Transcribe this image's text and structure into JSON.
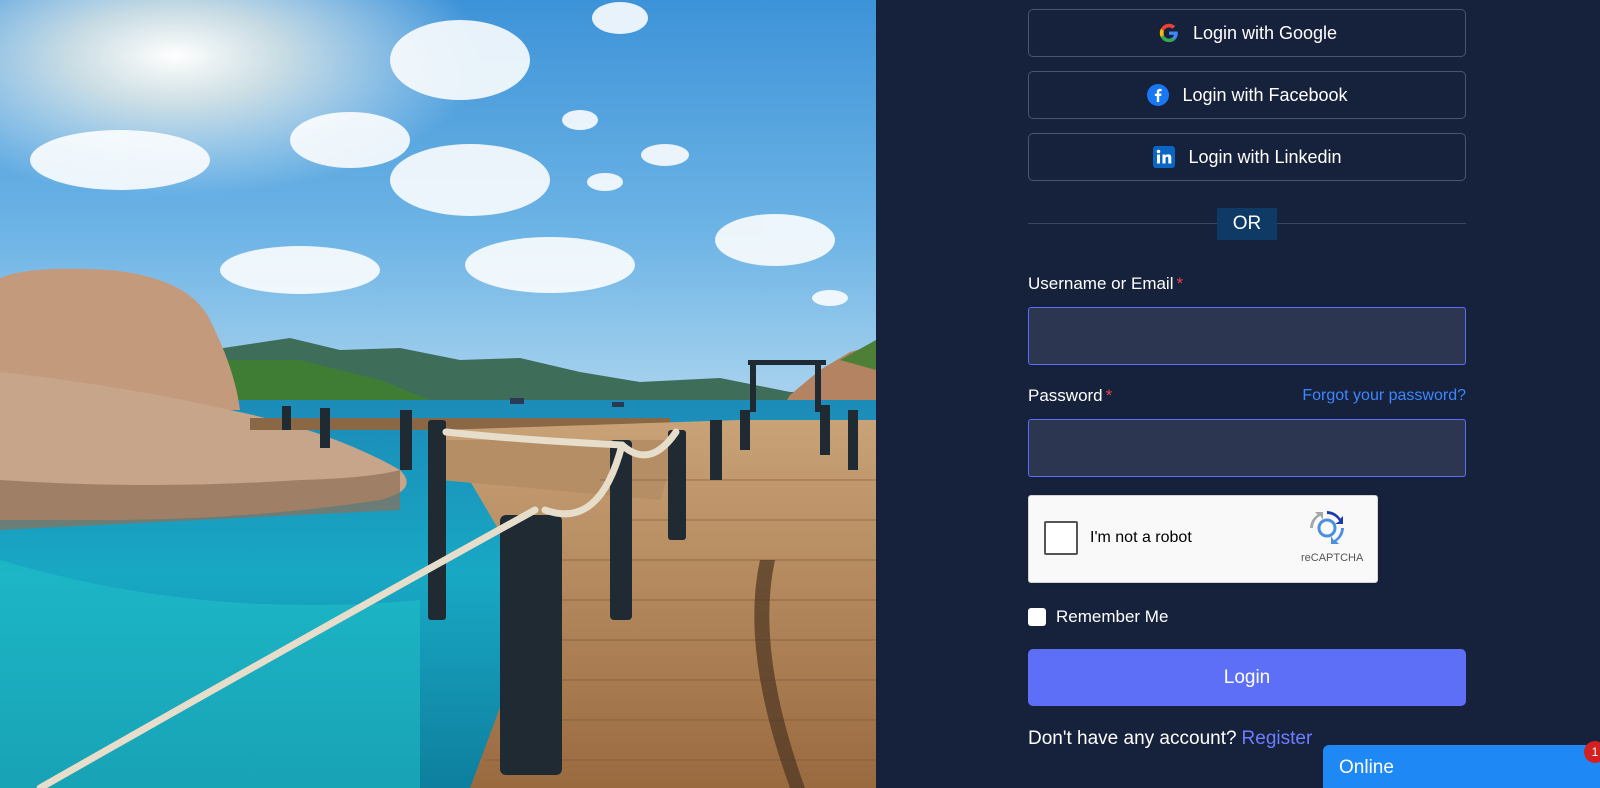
{
  "social": {
    "google_label": "Login with Google",
    "facebook_label": "Login with Facebook",
    "linkedin_label": "Login with Linkedin",
    "google_icon": "google-g-icon",
    "facebook_icon": "facebook-icon",
    "linkedin_icon": "linkedin-icon"
  },
  "divider": {
    "or_text": "OR"
  },
  "form": {
    "username_label": "Username or Email",
    "required_mark": "*",
    "username_value": "",
    "password_label": "Password",
    "password_value": "",
    "forgot_link": "Forgot your password?",
    "remember_label": "Remember Me",
    "remember_checked": false,
    "login_label": "Login",
    "no_account_text": "Don't have any account?",
    "register_link": "Register"
  },
  "captcha": {
    "label": "I'm not a robot",
    "brand": "reCAPTCHA",
    "checked": false
  },
  "chat": {
    "status": "Online",
    "badge_count": "1"
  },
  "colors": {
    "panel_bg": "#16213b",
    "input_bg": "#2d3651",
    "input_border": "#5e6cf5",
    "primary_button": "#5d6ff7",
    "link": "#3d86ff",
    "register_link": "#6e7dff",
    "required": "#e8434f",
    "or_badge": "#0f3a66",
    "chat_bg": "#1e88f5"
  },
  "hero_image": {
    "subject": "wooden pier over turquoise sea under a sunny sky"
  }
}
